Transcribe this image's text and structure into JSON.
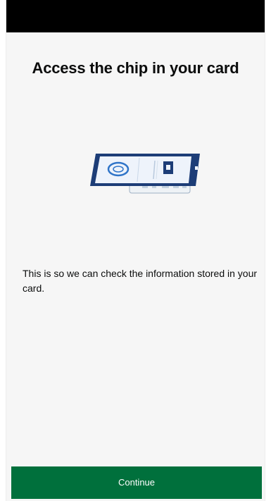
{
  "header": {
    "title": "Access the chip in your card"
  },
  "illustration": {
    "icon": "phone-reading-card-chip-illustration",
    "colors": {
      "phone_body": "#1d3d77",
      "phone_screen": "#eef3fb",
      "accent_blue": "#2f74c8",
      "card": "#e9eef3"
    }
  },
  "main": {
    "description": "This is so we can check the information stored in your card."
  },
  "footer": {
    "continue_label": "Continue",
    "button_color": "#00703c"
  }
}
